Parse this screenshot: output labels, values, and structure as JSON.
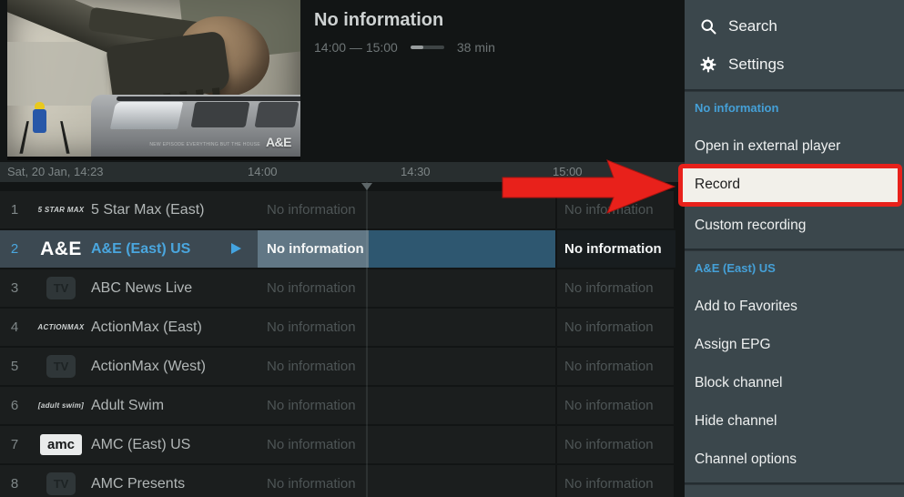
{
  "player": {
    "title": "No information",
    "time_range": "14:00 — 15:00",
    "remaining": "38 min",
    "progress_pct": 39,
    "watermark": "A&E",
    "caption": "NEW EPISODE EVERYTHING BUT THE HOUSE"
  },
  "timeline": {
    "date_label": "Sat, 20 Jan, 14:23",
    "ticks": [
      "14:00",
      "14:30",
      "15:00"
    ]
  },
  "epg": {
    "cell_label": "No information"
  },
  "channels": [
    {
      "num": "1",
      "name": "5 Star Max (East)",
      "logo": "5 STAR MAX",
      "logo_type": "text",
      "selected": false
    },
    {
      "num": "2",
      "name": "A&E (East) US",
      "logo": "A&E",
      "logo_type": "ae",
      "selected": true
    },
    {
      "num": "3",
      "name": "ABC News Live",
      "logo": "TV",
      "logo_type": "tv",
      "selected": false
    },
    {
      "num": "4",
      "name": "ActionMax (East)",
      "logo": "ACTIONMAX",
      "logo_type": "text",
      "selected": false
    },
    {
      "num": "5",
      "name": "ActionMax (West)",
      "logo": "TV",
      "logo_type": "tv",
      "selected": false
    },
    {
      "num": "6",
      "name": "Adult Swim",
      "logo": "[adult swim]",
      "logo_type": "text",
      "selected": false
    },
    {
      "num": "7",
      "name": "AMC (East) US",
      "logo": "amc",
      "logo_type": "amc",
      "selected": false
    },
    {
      "num": "8",
      "name": "AMC Presents",
      "logo": "TV",
      "logo_type": "tv",
      "selected": false
    }
  ],
  "menu": {
    "top_items": [
      {
        "label": "Search",
        "icon": "search-icon"
      },
      {
        "label": "Settings",
        "icon": "gear-icon"
      }
    ],
    "sections": [
      {
        "header": "No information",
        "items": [
          "Open in external player",
          "Record",
          "Custom recording"
        ]
      },
      {
        "header": "A&E (East) US",
        "items": [
          "Add to Favorites",
          "Assign EPG",
          "Block channel",
          "Hide channel",
          "Channel options"
        ]
      }
    ],
    "highlighted_item": "Record"
  },
  "colors": {
    "accent_blue": "#45a0d7",
    "selected_program_blue": "#2e5770",
    "elapsed_program_gray": "#617785",
    "sidebar_bg": "#3b474c",
    "annotation_red": "#e8211b",
    "record_highlight_bg": "#f2f0ea"
  }
}
